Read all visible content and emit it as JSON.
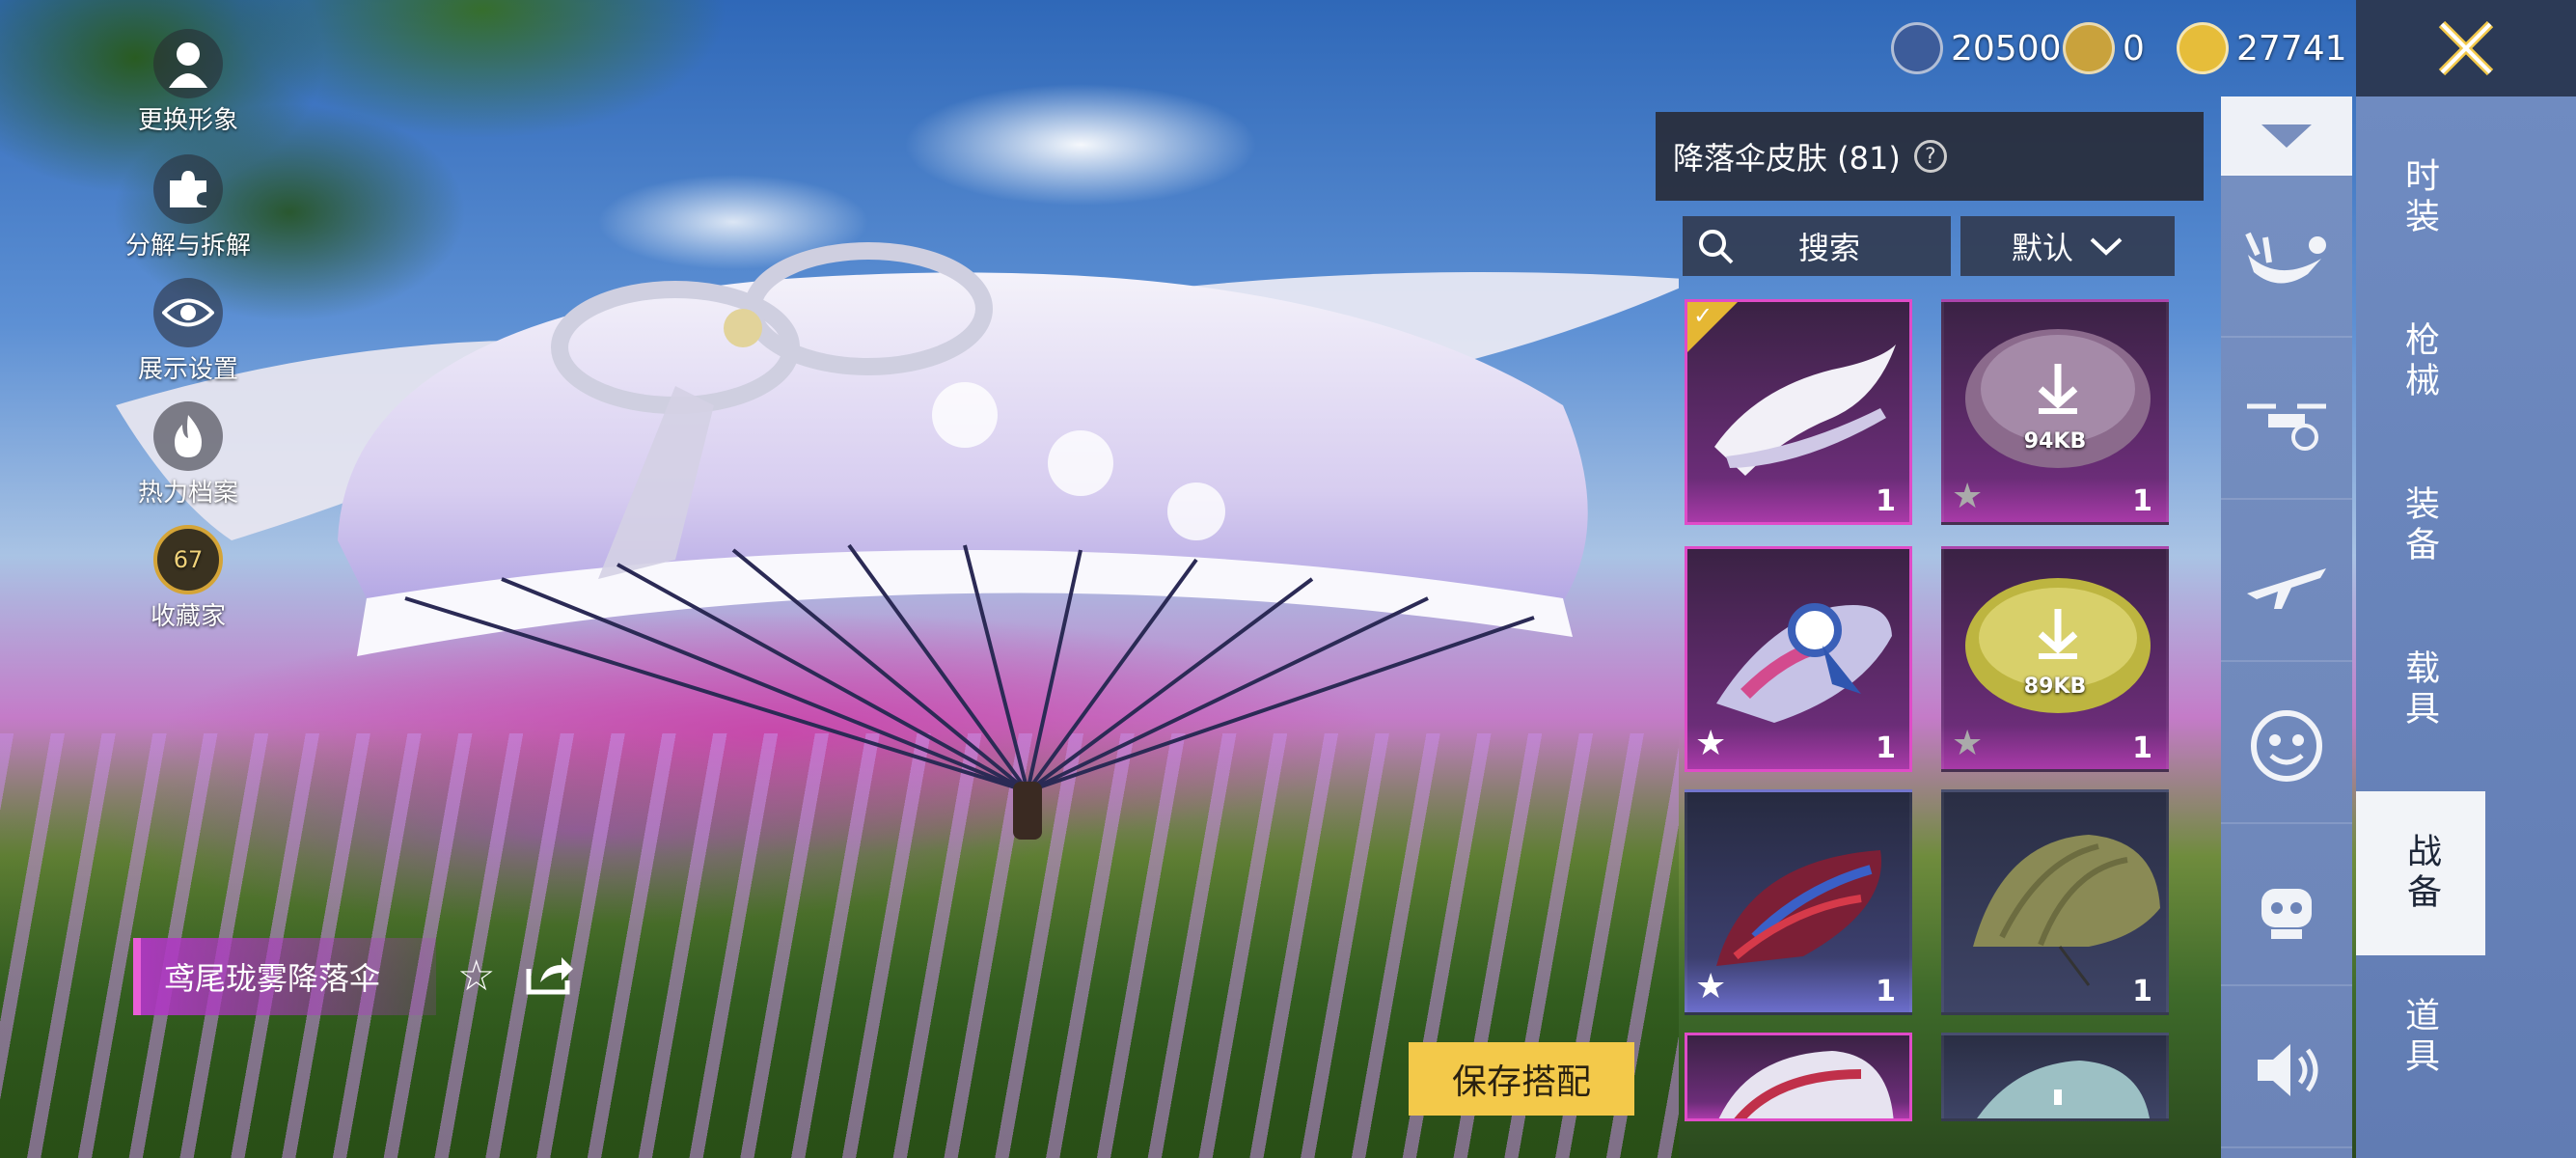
{
  "left_menu": [
    {
      "label": "更换形象",
      "icon": "person-icon"
    },
    {
      "label": "分解与拆解",
      "icon": "puzzle-icon"
    },
    {
      "label": "展示设置",
      "icon": "eye-icon"
    },
    {
      "label": "热力档案",
      "icon": "flame-icon"
    },
    {
      "label": "收藏家",
      "icon": "collector-badge-icon",
      "badge": "67"
    }
  ],
  "currencies": [
    {
      "value": "20500",
      "icon": "silver-coin-icon",
      "color": "#3d5c9a"
    },
    {
      "value": "0",
      "icon": "gold-token-icon",
      "color": "#c9a23c"
    },
    {
      "value": "27741",
      "icon": "gold-coin-icon",
      "color": "#e6bd3a"
    }
  ],
  "panel": {
    "title": "降落伞皮肤 (81)",
    "help": "?",
    "search_label": "搜索",
    "sort_label": "默认"
  },
  "items": [
    {
      "count": "1",
      "selected": true,
      "starred": false
    },
    {
      "count": "1",
      "download": "94KB",
      "starred": true
    },
    {
      "count": "1",
      "starred": true
    },
    {
      "count": "1",
      "download": "89KB",
      "starred": true
    },
    {
      "count": "1",
      "starred": true
    },
    {
      "count": "1",
      "starred": false
    }
  ],
  "categories": [
    {
      "label": "时装"
    },
    {
      "label": "枪械"
    },
    {
      "label": "装备"
    },
    {
      "label": "载具"
    },
    {
      "label": "战备",
      "active": true
    },
    {
      "label": "道具"
    }
  ],
  "subcategory_icons": [
    "top-partial-icon",
    "skydive-icon",
    "drone-icon",
    "airplane-icon",
    "emote-face-icon",
    "pet-icon",
    "speaker-icon"
  ],
  "skin_name": "鸢尾珑雾降落伞",
  "save_button": "保存搭配",
  "colors": {
    "accent_gold": "#f3c94a",
    "accent_pink": "#e04bc8",
    "panel_blue": "#6f8bc1"
  }
}
